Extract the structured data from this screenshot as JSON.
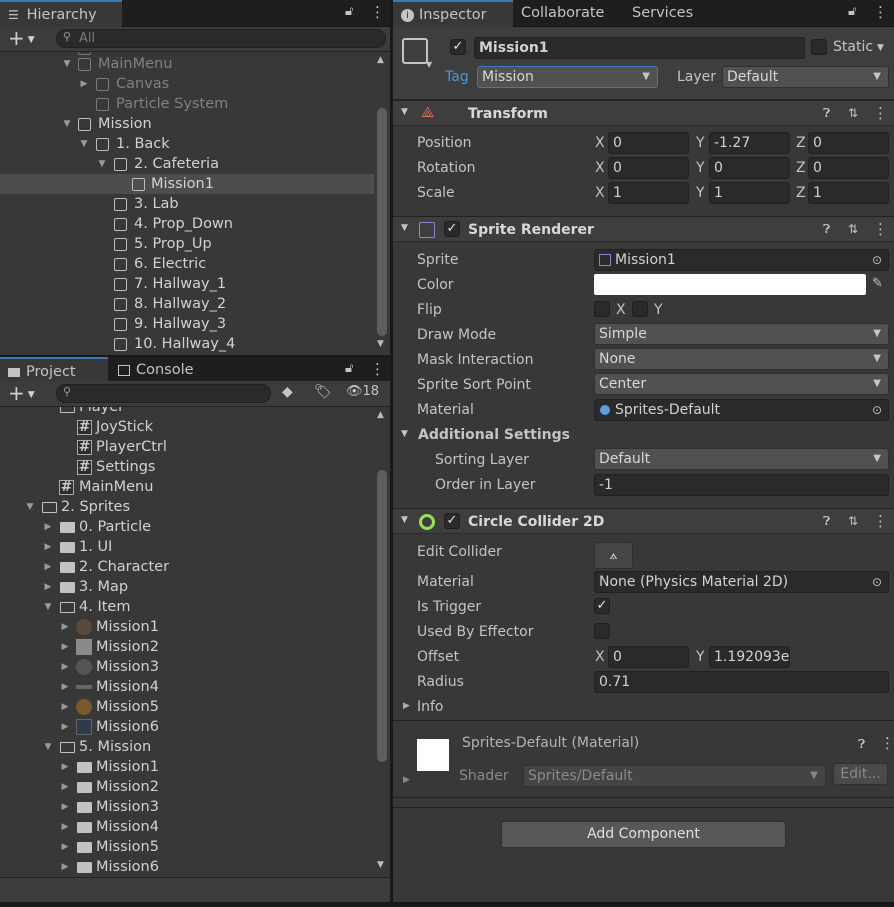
{
  "hierarchy": {
    "tab": "Hierarchy",
    "search_placeholder": "All",
    "items": [
      {
        "label": "MainMenu"
      },
      {
        "label": "Canvas"
      },
      {
        "label": "Particle System"
      },
      {
        "label": "Mission"
      },
      {
        "label": "1. Back"
      },
      {
        "label": "2. Cafeteria"
      },
      {
        "label": "Mission1"
      },
      {
        "label": "3. Lab"
      },
      {
        "label": "4. Prop_Down"
      },
      {
        "label": "5. Prop_Up"
      },
      {
        "label": "6. Electric"
      },
      {
        "label": "7. Hallway_1"
      },
      {
        "label": "8. Hallway_2"
      },
      {
        "label": "9. Hallway_3"
      },
      {
        "label": "10. Hallway_4"
      }
    ]
  },
  "project": {
    "tabs": [
      "Project",
      "Console"
    ],
    "hidden_count": "18",
    "items": [
      {
        "label": "Player"
      },
      {
        "label": "JoyStick"
      },
      {
        "label": "PlayerCtrl"
      },
      {
        "label": "Settings"
      },
      {
        "label": "MainMenu"
      },
      {
        "label": "2. Sprites"
      },
      {
        "label": "0. Particle"
      },
      {
        "label": "1. UI"
      },
      {
        "label": "2. Character"
      },
      {
        "label": "3. Map"
      },
      {
        "label": "4. Item"
      },
      {
        "label": "Mission1"
      },
      {
        "label": "Mission2"
      },
      {
        "label": "Mission3"
      },
      {
        "label": "Mission4"
      },
      {
        "label": "Mission5"
      },
      {
        "label": "Mission6"
      },
      {
        "label": "5. Mission"
      },
      {
        "label": "Mission1"
      },
      {
        "label": "Mission2"
      },
      {
        "label": "Mission3"
      },
      {
        "label": "Mission4"
      },
      {
        "label": "Mission5"
      },
      {
        "label": "Mission6"
      }
    ]
  },
  "inspector": {
    "tabs": [
      "Inspector",
      "Collaborate",
      "Services"
    ],
    "object_name": "Mission1",
    "static_label": "Static",
    "tag_label": "Tag",
    "tag_value": "Mission",
    "layer_label": "Layer",
    "layer_value": "Default",
    "transform": {
      "title": "Transform",
      "position_label": "Position",
      "rotation_label": "Rotation",
      "scale_label": "Scale",
      "x": "X",
      "y": "Y",
      "z": "Z",
      "position": [
        "0",
        "-1.27",
        "0"
      ],
      "rotation": [
        "0",
        "0",
        "0"
      ],
      "scale": [
        "1",
        "1",
        "1"
      ]
    },
    "sprite_renderer": {
      "title": "Sprite Renderer",
      "sprite_label": "Sprite",
      "sprite_value": "Mission1",
      "color_label": "Color",
      "color_value": "#ffffff",
      "flip_label": "Flip",
      "flip_x": "X",
      "flip_y": "Y",
      "draw_mode_label": "Draw Mode",
      "draw_mode_value": "Simple",
      "mask_label": "Mask Interaction",
      "mask_value": "None",
      "sort_point_label": "Sprite Sort Point",
      "sort_point_value": "Center",
      "material_label": "Material",
      "material_value": "Sprites-Default",
      "additional_label": "Additional Settings",
      "sorting_layer_label": "Sorting Layer",
      "sorting_layer_value": "Default",
      "order_label": "Order in Layer",
      "order_value": "-1"
    },
    "circle_collider": {
      "title": "Circle Collider 2D",
      "edit_label": "Edit Collider",
      "material_label": "Material",
      "material_value": "None (Physics Material 2D)",
      "trigger_label": "Is Trigger",
      "effector_label": "Used By Effector",
      "offset_label": "Offset",
      "offset_x": "0",
      "offset_y": "1.192093e",
      "radius_label": "Radius",
      "radius_value": "0.71",
      "info_label": "Info"
    },
    "material_block": {
      "name": "Sprites-Default (Material)",
      "shader_label": "Shader",
      "shader_value": "Sprites/Default",
      "edit_button": "Edit..."
    },
    "add_component": "Add Component"
  }
}
